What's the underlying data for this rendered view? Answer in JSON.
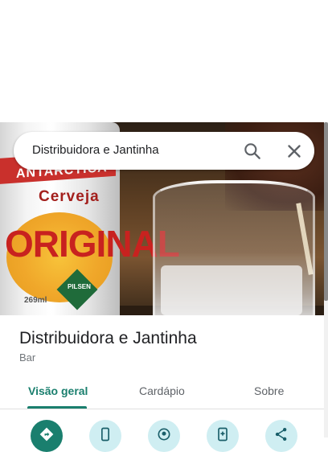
{
  "search": {
    "query": "Distribuidora e Jantinha"
  },
  "place": {
    "name": "Distribuidora e Jantinha",
    "category": "Bar"
  },
  "tabs": [
    {
      "label": "Visão geral",
      "active": true
    },
    {
      "label": "Cardápio",
      "active": false
    },
    {
      "label": "Sobre",
      "active": false
    }
  ],
  "photo": {
    "can_text": [
      "ANTARCTICA",
      "Cerveja",
      "ORIGINAL",
      "PILSEN",
      "269ml"
    ]
  },
  "actions": [
    {
      "icon": "directions-icon"
    },
    {
      "icon": "phone-icon"
    },
    {
      "icon": "save-pin-icon"
    },
    {
      "icon": "nearby-icon"
    },
    {
      "icon": "share-icon"
    }
  ],
  "colors": {
    "accent": "#1a7f6e",
    "action_bg": "#cfeef2",
    "text_primary": "#202124",
    "text_secondary": "#70757a"
  }
}
